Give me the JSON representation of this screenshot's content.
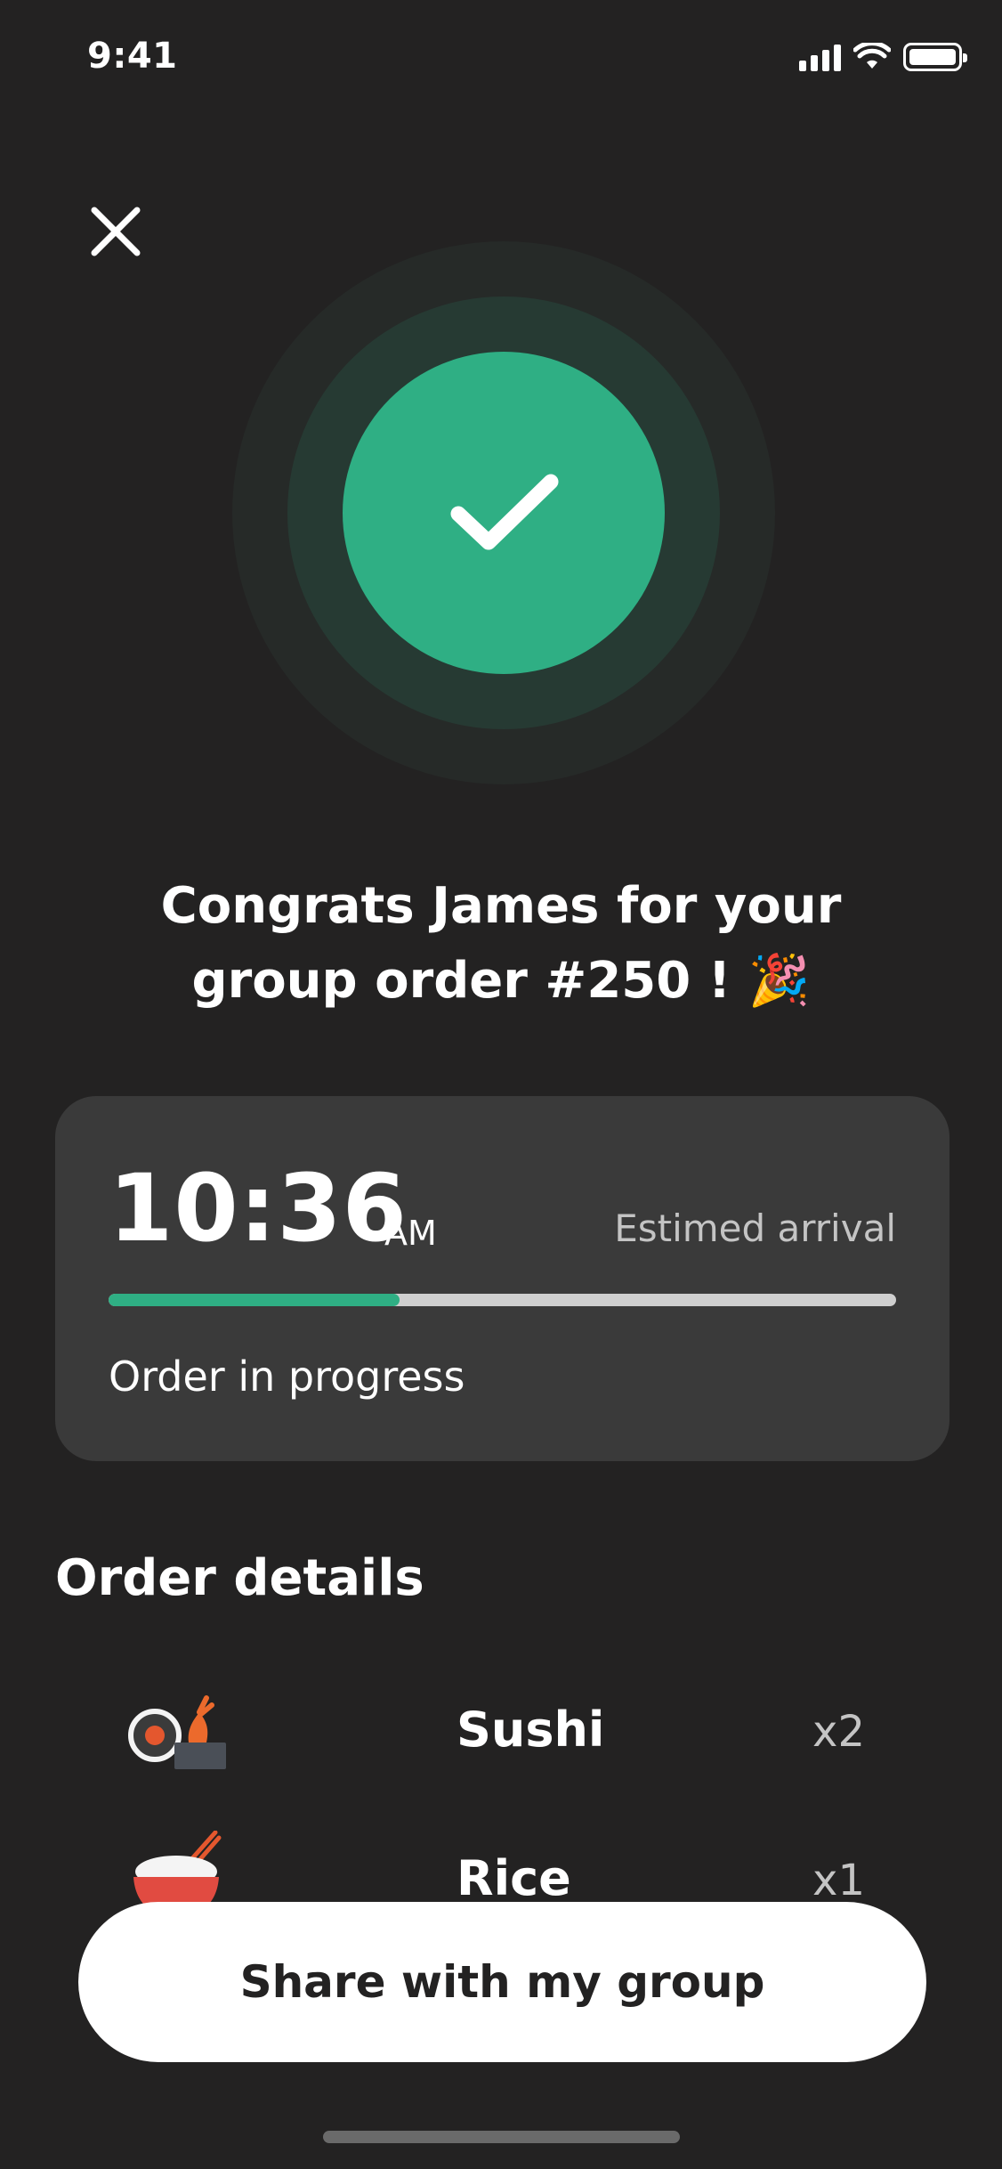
{
  "status_bar": {
    "time": "9:41",
    "icons": [
      "signal-icon",
      "wifi-icon",
      "battery-icon"
    ]
  },
  "close_icon": "close-icon",
  "success_icon": "checkmark-icon",
  "congrats": {
    "line1": "Congrats James for your",
    "line2": "group order #250 !",
    "emoji": "🎉"
  },
  "eta": {
    "time": "10:36",
    "ampm": "AM",
    "label": "Estimed arrival",
    "progress": 0.37,
    "status": "Order in progress"
  },
  "order_details": {
    "title": "Order details",
    "items": [
      {
        "name": "Sushi",
        "qty": "x2",
        "icon": "sushi-icon"
      },
      {
        "name": "Rice",
        "qty": "x1",
        "icon": "rice-bowl-icon"
      }
    ]
  },
  "share_button": {
    "label": "Share with my group"
  },
  "colors": {
    "background": "#232222",
    "accent": "#2faf84",
    "card": "#3a3a3a",
    "muted_text": "#c4c4c4"
  }
}
